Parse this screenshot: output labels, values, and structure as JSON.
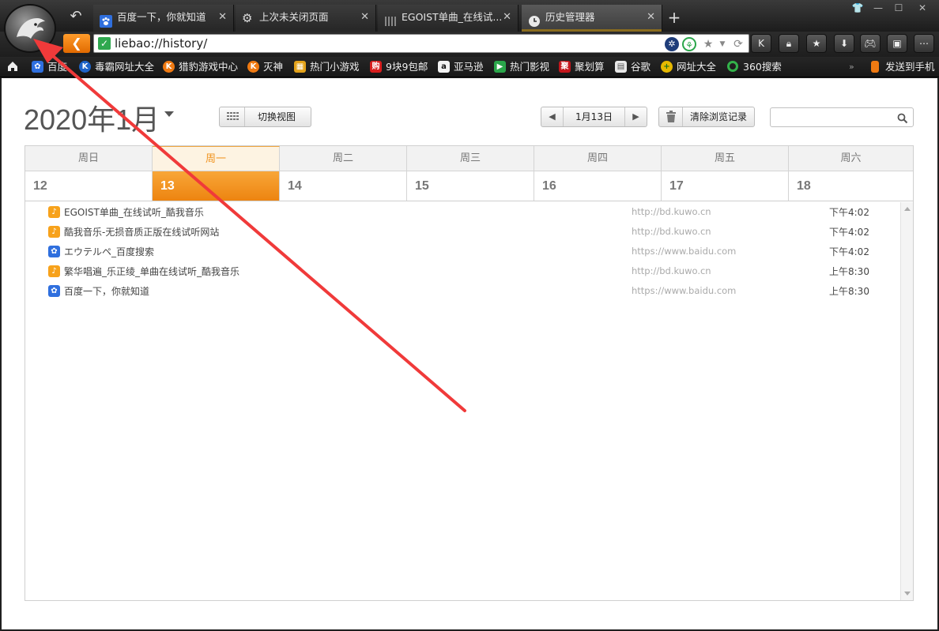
{
  "window": {
    "controls": [
      "shirt-icon",
      "minimize-icon",
      "maximize-icon",
      "close-icon"
    ]
  },
  "tabs": [
    {
      "title": "百度一下，你就知道",
      "icon": "baidu-paw-icon",
      "active": false
    },
    {
      "title": "上次未关闭页面",
      "icon": "gear-icon",
      "active": false
    },
    {
      "title": "EGOIST单曲_在线试...",
      "icon": "page-icon",
      "active": false
    },
    {
      "title": "历史管理器",
      "icon": "clock-icon",
      "active": true
    }
  ],
  "address_bar": {
    "url": "liebao://history/"
  },
  "bookmarks": [
    {
      "label": "百度",
      "icon": "baidu-paw-icon",
      "color": "#2f6fde"
    },
    {
      "label": "毒霸网址大全",
      "icon": "k-icon",
      "color": "#1e63c8"
    },
    {
      "label": "猎豹游戏中心",
      "icon": "k-icon",
      "color": "#f07a12"
    },
    {
      "label": "灭神",
      "icon": "k-icon",
      "color": "#f07a12"
    },
    {
      "label": "热门小游戏",
      "icon": "game-icon",
      "color": "#e3a21a"
    },
    {
      "label": "9块9包邮",
      "icon": "gou-icon",
      "color": "#d81e1e"
    },
    {
      "label": "亚马逊",
      "icon": "amazon-icon",
      "color": "#333333"
    },
    {
      "label": "热门影视",
      "icon": "play-icon",
      "color": "#2aa64a"
    },
    {
      "label": "聚划算",
      "icon": "ju-icon",
      "color": "#c4161c"
    },
    {
      "label": "谷歌",
      "icon": "doc-icon",
      "color": "#dddddd"
    },
    {
      "label": "网址大全",
      "icon": "plus-icon",
      "color": "#e6b800"
    },
    {
      "label": "360搜索",
      "icon": "circle-icon",
      "color": "#33b24a"
    }
  ],
  "send_to_phone": "发送到手机",
  "toolbar": {
    "month_title": "2020年1月",
    "switch_view": "切换视图",
    "current_date": "1月13日",
    "clear_history": "清除浏览记录",
    "search_placeholder": ""
  },
  "weekdays": [
    "周日",
    "周一",
    "周二",
    "周三",
    "周四",
    "周五",
    "周六"
  ],
  "days": [
    "12",
    "13",
    "14",
    "15",
    "16",
    "17",
    "18"
  ],
  "selected_index": 1,
  "entries": [
    {
      "title": "EGOIST单曲_在线试听_酷我音乐",
      "url": "http://bd.kuwo.cn",
      "time": "下午4:02",
      "icon": "kuwo-icon"
    },
    {
      "title": "酷我音乐-无损音质正版在线试听网站",
      "url": "http://bd.kuwo.cn",
      "time": "下午4:02",
      "icon": "kuwo-icon"
    },
    {
      "title": "エウテルペ_百度搜索",
      "url": "https://www.baidu.com",
      "time": "下午4:02",
      "icon": "baidu-paw-icon"
    },
    {
      "title": "繁华唱遍_乐正绫_单曲在线试听_酷我音乐",
      "url": "http://bd.kuwo.cn",
      "time": "上午8:30",
      "icon": "kuwo-icon"
    },
    {
      "title": "百度一下，你就知道",
      "url": "https://www.baidu.com",
      "time": "上午8:30",
      "icon": "baidu-paw-icon"
    }
  ],
  "colors": {
    "accent": "#f0931f",
    "arrow": "#f03a3a"
  }
}
